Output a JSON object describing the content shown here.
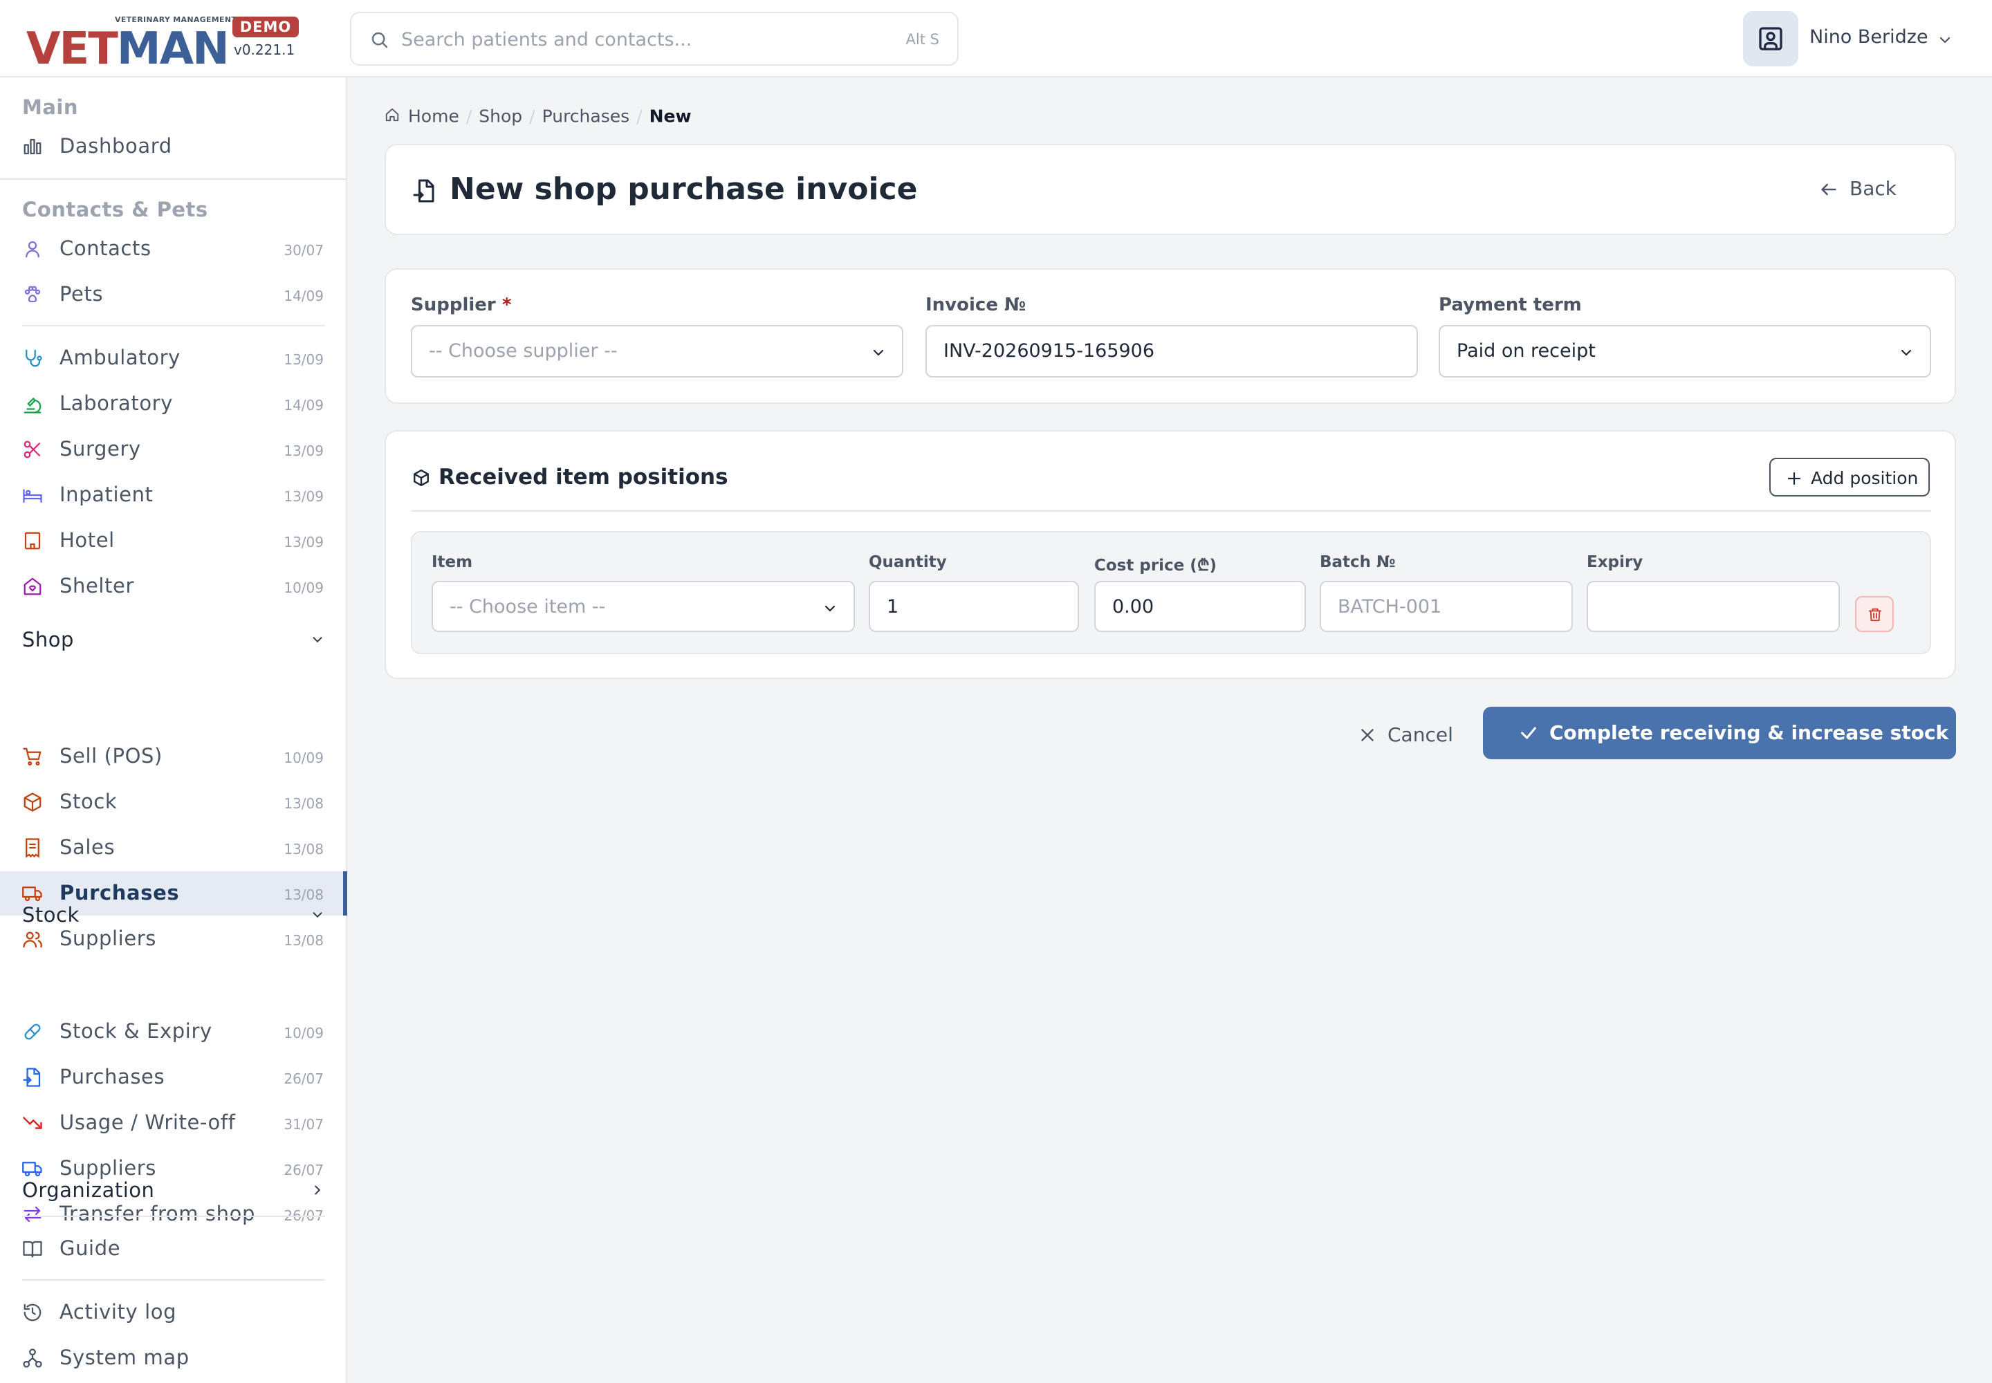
{
  "app": {
    "logo_vet": "VET",
    "logo_man": "MAN",
    "logo_sub": "VETERINARY MANAGEMENT",
    "badge": "DEMO",
    "version": "v0.221.1"
  },
  "search": {
    "placeholder": "Search patients and contacts...",
    "shortcut": "Alt S"
  },
  "user": {
    "name": "Nino Beridze"
  },
  "sidebar": {
    "main_heading": "Main",
    "dashboard": "Dashboard",
    "contacts_heading": "Contacts & Pets",
    "contacts": {
      "label": "Contacts",
      "date": "30/07"
    },
    "pets": {
      "label": "Pets",
      "date": "14/09"
    },
    "ambulatory": {
      "label": "Ambulatory",
      "date": "13/09"
    },
    "laboratory": {
      "label": "Laboratory",
      "date": "14/09"
    },
    "surgery": {
      "label": "Surgery",
      "date": "13/09"
    },
    "inpatient": {
      "label": "Inpatient",
      "date": "13/09"
    },
    "hotel": {
      "label": "Hotel",
      "date": "13/09"
    },
    "shelter": {
      "label": "Shelter",
      "date": "10/09"
    },
    "shop_group": "Shop",
    "sell_pos": {
      "label": "Sell (POS)",
      "date": "10/09"
    },
    "shop_stock": {
      "label": "Stock",
      "date": "13/08"
    },
    "sales": {
      "label": "Sales",
      "date": "13/08"
    },
    "shop_purchases": {
      "label": "Purchases",
      "date": "13/08"
    },
    "shop_suppliers": {
      "label": "Suppliers",
      "date": "13/08"
    },
    "stock_group": "Stock",
    "stock_expiry": {
      "label": "Stock & Expiry",
      "date": "10/09"
    },
    "stock_purchases": {
      "label": "Purchases",
      "date": "26/07"
    },
    "usage": {
      "label": "Usage / Write-off",
      "date": "31/07"
    },
    "stock_suppliers": {
      "label": "Suppliers",
      "date": "26/07"
    },
    "transfer": {
      "label": "Transfer from shop",
      "date": "26/07"
    },
    "organization_group": "Organization",
    "guide": "Guide",
    "activity_log": "Activity log",
    "system_map": "System map"
  },
  "breadcrumb": {
    "home": "Home",
    "shop": "Shop",
    "purchases": "Purchases",
    "current": "New"
  },
  "page": {
    "title": "New shop purchase invoice",
    "back": "Back"
  },
  "form": {
    "supplier_label": "Supplier",
    "required_mark": "*",
    "supplier_value": "-- Choose supplier --",
    "invoice_label": "Invoice №",
    "invoice_value": "INV-20260915-165906",
    "payment_label": "Payment term",
    "payment_value": "Paid on receipt"
  },
  "positions": {
    "title": "Received item positions",
    "add_button": "Add position",
    "columns": {
      "item": "Item",
      "quantity": "Quantity",
      "cost_price": "Cost price (₾)",
      "batch": "Batch №",
      "expiry": "Expiry"
    },
    "row": {
      "item": "-- Choose item --",
      "quantity": "1",
      "cost_price": "0.00",
      "batch_placeholder": "BATCH-001",
      "expiry": ""
    }
  },
  "actions": {
    "cancel": "Cancel",
    "complete": "Complete receiving & increase stock"
  },
  "colors": {
    "brand_red": "#b5403c",
    "brand_blue": "#3b5f96",
    "primary_button": "#4a72ad",
    "active_bg": "#e6ebf3"
  }
}
